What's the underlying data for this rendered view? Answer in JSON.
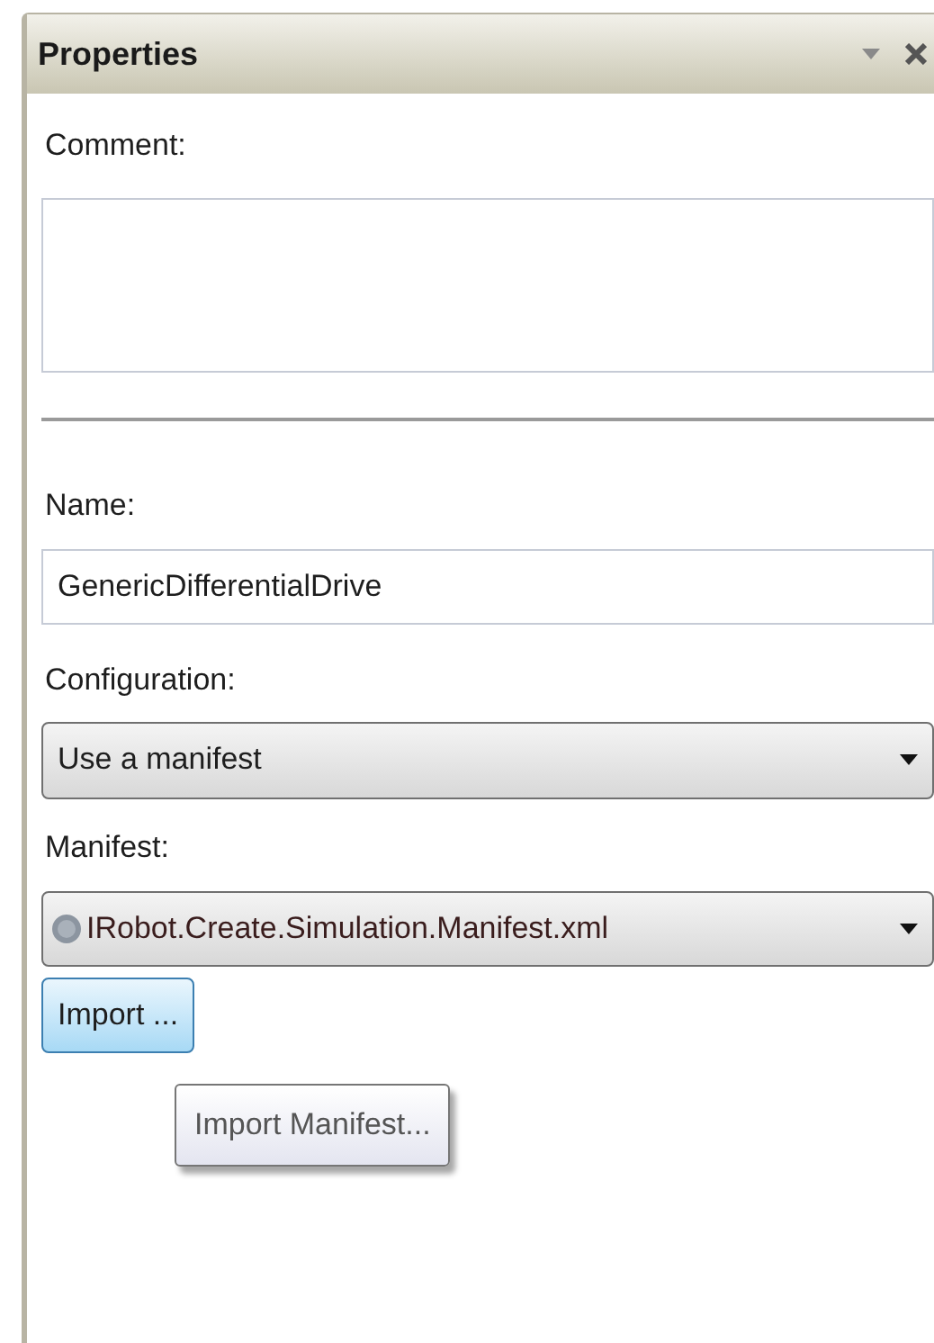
{
  "panel": {
    "title": "Properties"
  },
  "comment": {
    "label": "Comment:"
  },
  "name": {
    "label": "Name:",
    "value": "GenericDifferentialDrive"
  },
  "configuration": {
    "label": "Configuration:",
    "value": "Use a manifest"
  },
  "manifest": {
    "label": "Manifest:",
    "value": "IRobot.Create.Simulation.Manifest.xml"
  },
  "import_button": {
    "label": "Import ..."
  },
  "tooltip": {
    "text": "Import Manifest..."
  }
}
